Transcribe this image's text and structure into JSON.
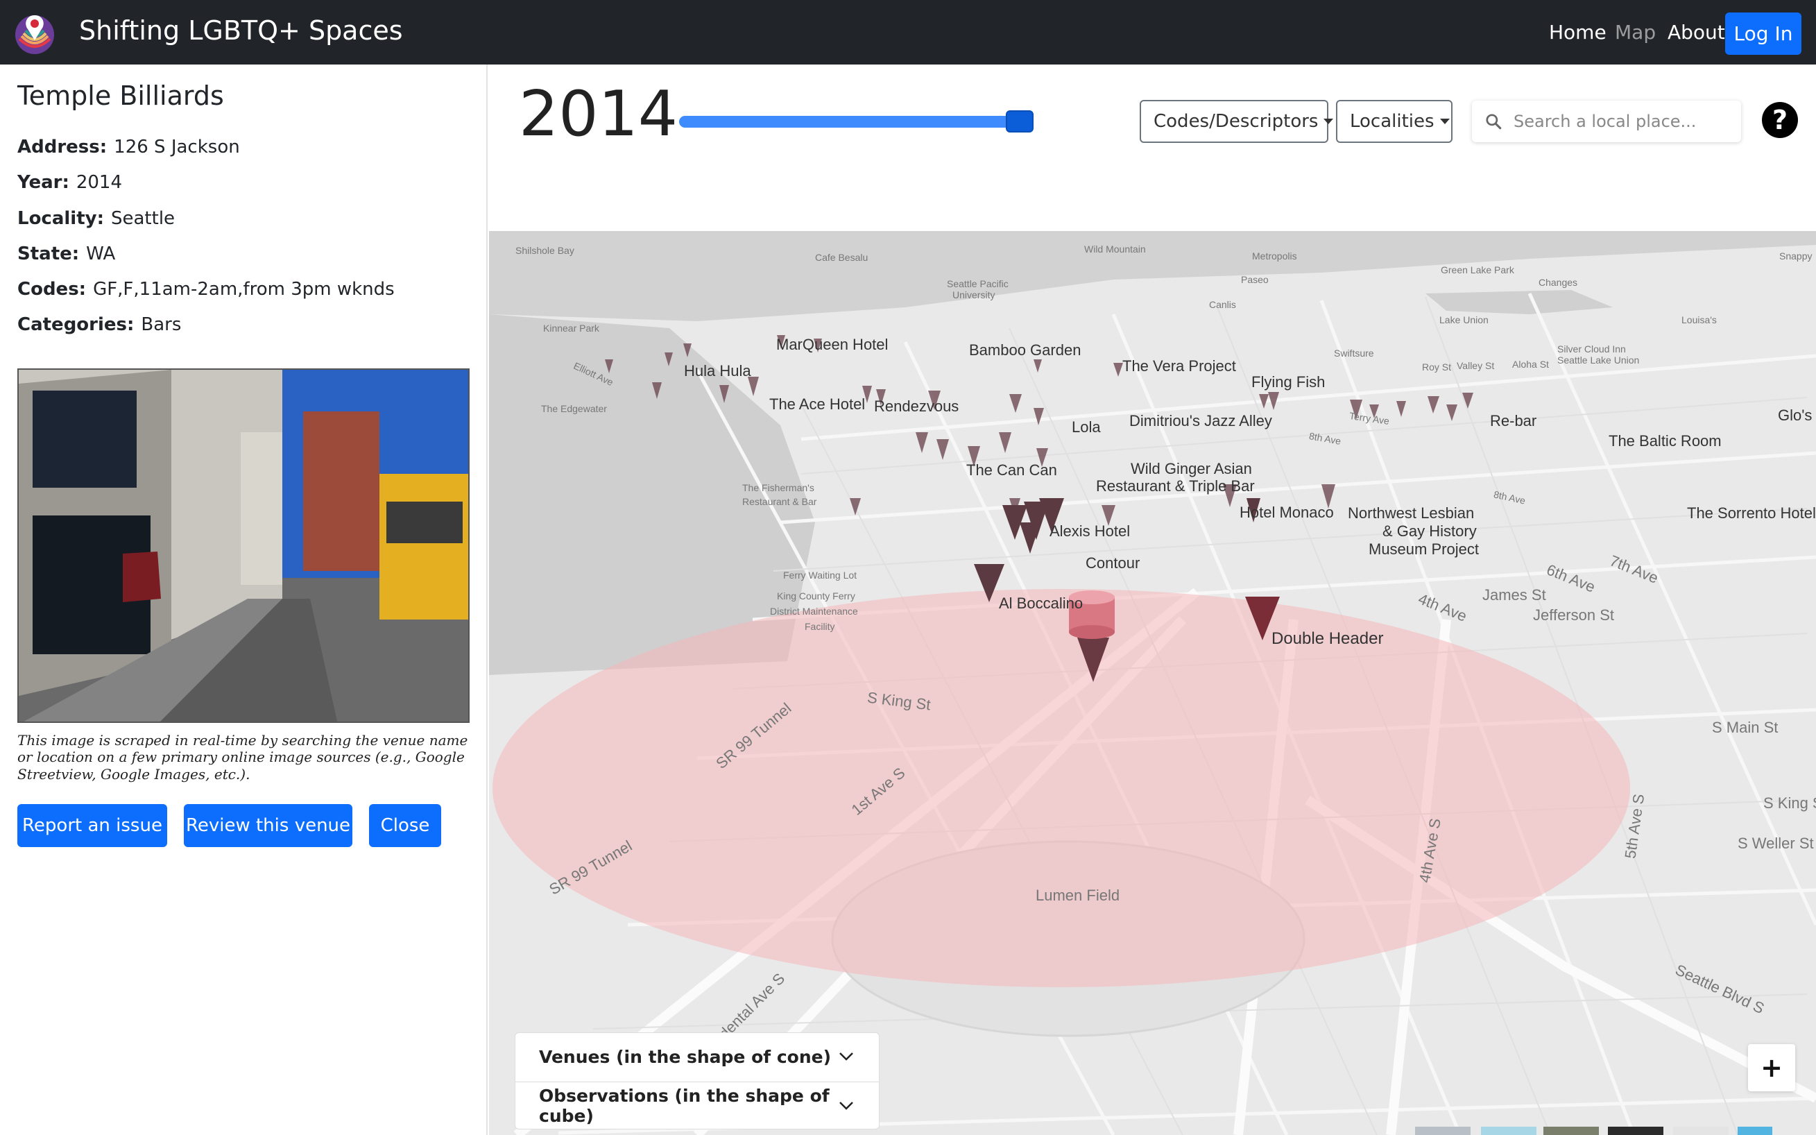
{
  "navbar": {
    "brand": "Shifting LGBTQ+ Spaces",
    "links": {
      "home": "Home",
      "map": "Map",
      "about": "About"
    },
    "login": "Log In"
  },
  "venue": {
    "name": "Temple Billiards",
    "fields": [
      {
        "label": "Address:",
        "value": "126 S Jackson"
      },
      {
        "label": "Year:",
        "value": "2014"
      },
      {
        "label": "Locality:",
        "value": "Seattle"
      },
      {
        "label": "State:",
        "value": "WA"
      },
      {
        "label": "Codes:",
        "value": "GF,F,11am-2am,from 3pm wknds"
      },
      {
        "label": "Categories:",
        "value": "Bars"
      }
    ],
    "photo_caption": "This image is scraped in real-time by searching the venue name or location on a few primary online image sources (e.g., Google Streetview, Google Images, etc.).",
    "buttons": {
      "report": "Report an issue",
      "review": "Review this venue",
      "close": "Close"
    }
  },
  "controls": {
    "year": "2014",
    "slider_value_fraction": 1.0,
    "codes_dropdown": "Codes/Descriptors",
    "localities_dropdown": "Localities",
    "search_placeholder": "Search a local place...",
    "help": "?"
  },
  "map": {
    "venue_labels": [
      "MarQueen Hotel",
      "Bamboo Garden",
      "Hula Hula",
      "The Vera Project",
      "Flying Fish",
      "The Ace Hotel",
      "Rendezvous",
      "Lola",
      "Dimitriou's Jazz Alley",
      "Re-bar",
      "The Baltic Room",
      "Glo's",
      "The Can Can",
      "Wild Ginger Asian",
      "Restaurant & Triple Bar",
      "Hotel Monaco",
      "Northwest Lesbian",
      "& Gay History",
      "Museum Project",
      "The Sorrento Hotel",
      "Alexis Hotel",
      "Contour",
      "Al Boccalino",
      "Double Header"
    ],
    "streets": [
      "S King St",
      "SR 99 Tunnel",
      "1st Ave S",
      "SR 99 Tunnel",
      "Lumen Field",
      "Occidental Ave S",
      "4th Ave S",
      "5th Ave S",
      "Seattle Blvd S",
      "James St",
      "Jefferson St",
      "S Main St",
      "S King St",
      "S Weller St",
      "6th Ave",
      "7th Ave",
      "4th Ave",
      "8th Ave",
      "8th Ave",
      "Terry Ave"
    ],
    "small_labels": [
      "Shilshole Bay",
      "Cafe Besalu",
      "Wild Mountain",
      "Metropolis",
      "Paseo",
      "Canlis",
      "Green Lake Park",
      "Changes",
      "Louisa's",
      "Lake Union",
      "Snappy",
      "The Edgewater",
      "The Fisherman's",
      "Restaurant & Bar",
      "Ferry Waiting Lot",
      "King County Ferry",
      "District Maintenance",
      "Facility",
      "Seattle Pacific",
      "University",
      "Kinnear Park",
      "Elliott Ave",
      "Swiftsure",
      "Silver Cloud Inn",
      "Seattle Lake Union",
      "Roy St",
      "Valley St",
      "Aloha St"
    ]
  },
  "legend": {
    "venues": "Venues (in the shape of cone)",
    "observations": "Observations (in the shape of cube)"
  },
  "zoom": "+",
  "colors": {
    "navbar": "#212529",
    "primary": "#0d6efd",
    "radius": "#f4b3b6",
    "cone": "#7a4a52"
  }
}
